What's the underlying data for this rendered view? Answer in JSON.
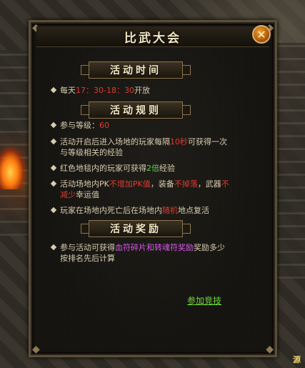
{
  "window": {
    "title": "比武大会",
    "close_label": "✕"
  },
  "sections": {
    "time": {
      "header": "活动时间"
    },
    "rules": {
      "header": "活动规则"
    },
    "rewards": {
      "header": "活动奖励"
    }
  },
  "time_item": {
    "prefix": "每天",
    "range": "17：30-18：30",
    "suffix": "开放"
  },
  "rules": [
    {
      "p1": "参与等级：",
      "level": "60"
    },
    {
      "p1": "活动开启后进入场地的玩家每隔",
      "interval": "10秒",
      "p2": "可获得一次与等级相关的经验"
    },
    {
      "p1": "红色地毯内的玩家可获得",
      "mult": "2倍",
      "p2": "经验"
    },
    {
      "p1": "活动场地内PK",
      "pk": "不增加PK值",
      "p2": "，装备",
      "drop": "不掉落",
      "p3": "，武器",
      "luck": "不减少",
      "p4": "幸运值"
    },
    {
      "p1": "玩家在场地内死亡后在场地内",
      "random": "随机",
      "p2": "地点复活"
    }
  ],
  "reward": {
    "p1": "参与活动可获得",
    "items": "血符碎片和转魂符奖励",
    "p2": "奖励多少按排名先后计算"
  },
  "join_link": "参加竞技",
  "corner_tag": "源"
}
